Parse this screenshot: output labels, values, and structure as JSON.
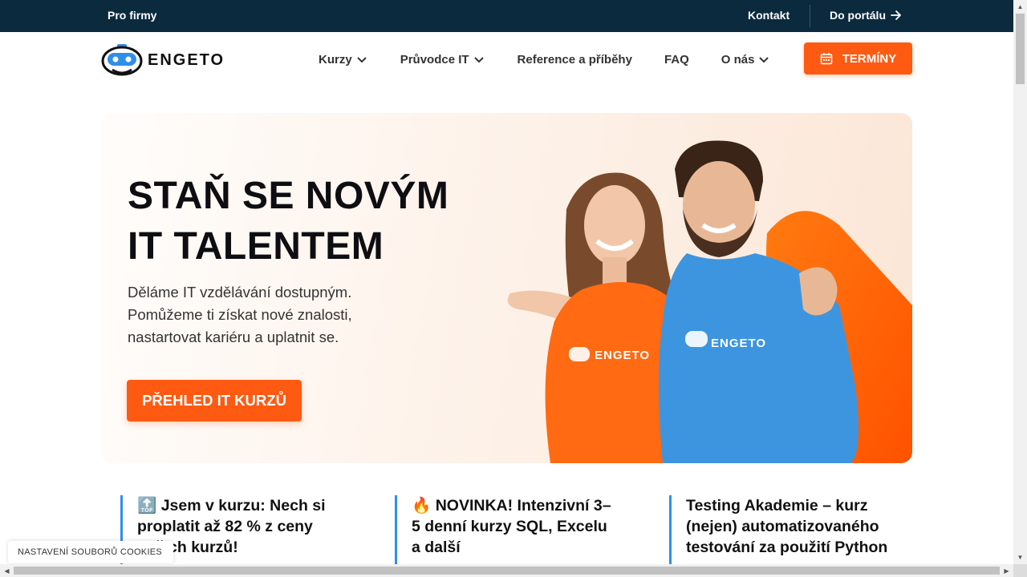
{
  "topbar": {
    "pro_firmy": "Pro firmy",
    "kontakt": "Kontakt",
    "do_portalu": "Do portálu",
    "arrow_icon": "arrow-right-icon"
  },
  "nav": {
    "logo_text": "ENGETO",
    "items": [
      {
        "label": "Kurzy",
        "has_dropdown": true
      },
      {
        "label": "Průvodce IT",
        "has_dropdown": true
      },
      {
        "label": "Reference a příběhy",
        "has_dropdown": false
      },
      {
        "label": "FAQ",
        "has_dropdown": false
      },
      {
        "label": "O nás",
        "has_dropdown": true
      }
    ],
    "terminy_label": "TERMÍNY",
    "terminy_icon": "calendar-icon"
  },
  "hero": {
    "title_line1": "STAŇ SE NOVÝM",
    "title_line2": "IT TALENTEM",
    "text_line1": "Děláme IT vzdělávání dostupným.",
    "text_line2": "Pomůžeme ti získat nové znalosti,",
    "text_line3": "nastartovat kariéru a uplatnit se.",
    "cta_label": "PŘEHLED IT KURZŮ",
    "shirt_logo_text": "ENGETO"
  },
  "news": [
    {
      "emoji": "🔝",
      "text": "Jsem v kurzu: Nech si proplatit až 82 % z ceny našich kurzů!"
    },
    {
      "emoji": "🔥",
      "text": "NOVINKA! Intenzivní 3–5 denní kurzy SQL, Excelu a další"
    },
    {
      "emoji": "",
      "text": "Testing Akademie – kurz (nejen) automatizovaného testování za použití Python"
    }
  ],
  "cookie_label": "NASTAVENÍ SOUBORŮ COOKIES",
  "colors": {
    "brand_orange": "#ff5a12",
    "topbar_navy": "#0b2a3d",
    "accent_blue": "#2f8fe8"
  }
}
